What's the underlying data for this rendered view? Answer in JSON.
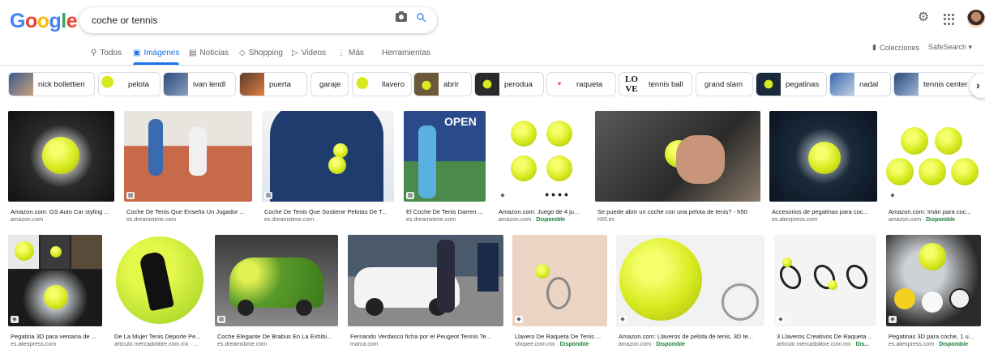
{
  "header": {
    "logo": [
      "G",
      "o",
      "o",
      "g",
      "l",
      "e"
    ],
    "logo_colors": [
      "#4285f4",
      "#ea4335",
      "#fbbc05",
      "#4285f4",
      "#34a853",
      "#ea4335"
    ],
    "search_value": "coche or tennis"
  },
  "tabs": {
    "todos": "Todos",
    "imagenes": "Imágenes",
    "noticias": "Noticias",
    "shopping": "Shopping",
    "videos": "Videos",
    "mas": "Más",
    "herramientas": "Herramientas"
  },
  "right_links": {
    "colecciones": "Colecciones",
    "safesearch": "SafeSearch ▾"
  },
  "chips": [
    {
      "label": "nick bollettieri"
    },
    {
      "label": "pelota"
    },
    {
      "label": "ivan lendl"
    },
    {
      "label": "puerta"
    },
    {
      "label": "garaje"
    },
    {
      "label": "llavero"
    },
    {
      "label": "abrir"
    },
    {
      "label": "perodua"
    },
    {
      "label": "raqueta"
    },
    {
      "label": "tennis ball"
    },
    {
      "label": "grand slam"
    },
    {
      "label": "pegatinas"
    },
    {
      "label": "nadal"
    },
    {
      "label": "tennis center"
    }
  ],
  "results_row1": [
    {
      "title": "Amazon.com: GS Auto Car styling ...",
      "source": "amazon.com",
      "avail": ""
    },
    {
      "title": "Coche De Tenis Que Enseña Un Jugador ...",
      "source": "es.dreamstime.com",
      "avail": ""
    },
    {
      "title": "Coche De Tenis Que Sostiene Pelotas De T...",
      "source": "es.dreamstime.com",
      "avail": ""
    },
    {
      "title": "El Coche De Tenis Darren ...",
      "source": "es.dreamstime.com",
      "avail": ""
    },
    {
      "title": "Amazon.com: Juego de 4 ju...",
      "source": "amazon.com · ",
      "avail": "Disponible"
    },
    {
      "title": "Se puede abrir un coche con una pelota de tenis? - h50",
      "source": "h50.es",
      "avail": ""
    },
    {
      "title": "Accesorios de pegatinas para coc...",
      "source": "es.aliexpress.com",
      "avail": ""
    },
    {
      "title": "Amazon.com: Imán para coc...",
      "source": "amazon.com · ",
      "avail": "Disponible"
    }
  ],
  "results_row2": [
    {
      "title": "Pegatina 3D para ventana de ...",
      "source": "es.aliexpress.com",
      "avail": ""
    },
    {
      "title": "De La Mujer Tenis Deporte Pe...",
      "source": "articulo.mercadolibre.com.mx · ...",
      "avail": ""
    },
    {
      "title": "Coche Elegante De Brabus En La Exhibi...",
      "source": "es.dreamstime.com",
      "avail": ""
    },
    {
      "title": "Fernando Verdasco ficha por el Peugeot Tennis Te...",
      "source": "marca.com",
      "avail": ""
    },
    {
      "title": "Llavero De Raqueta De Tenis ...",
      "source": "shopee.com.mx · ",
      "avail": "Disponible"
    },
    {
      "title": "Amazon.com: Llaveros de pelota de tenis, 3D te...",
      "source": "amazon.com · ",
      "avail": "Disponible"
    },
    {
      "title": "3 Llaveros Creativos De Raqueta ...",
      "source": "articulo.mercadolibre.com.mx · ",
      "avail": "Dis..."
    },
    {
      "title": "Pegatinas 3D para coche, 1 u...",
      "source": "es.aliexpress.com · ",
      "avail": "Disponible"
    }
  ]
}
